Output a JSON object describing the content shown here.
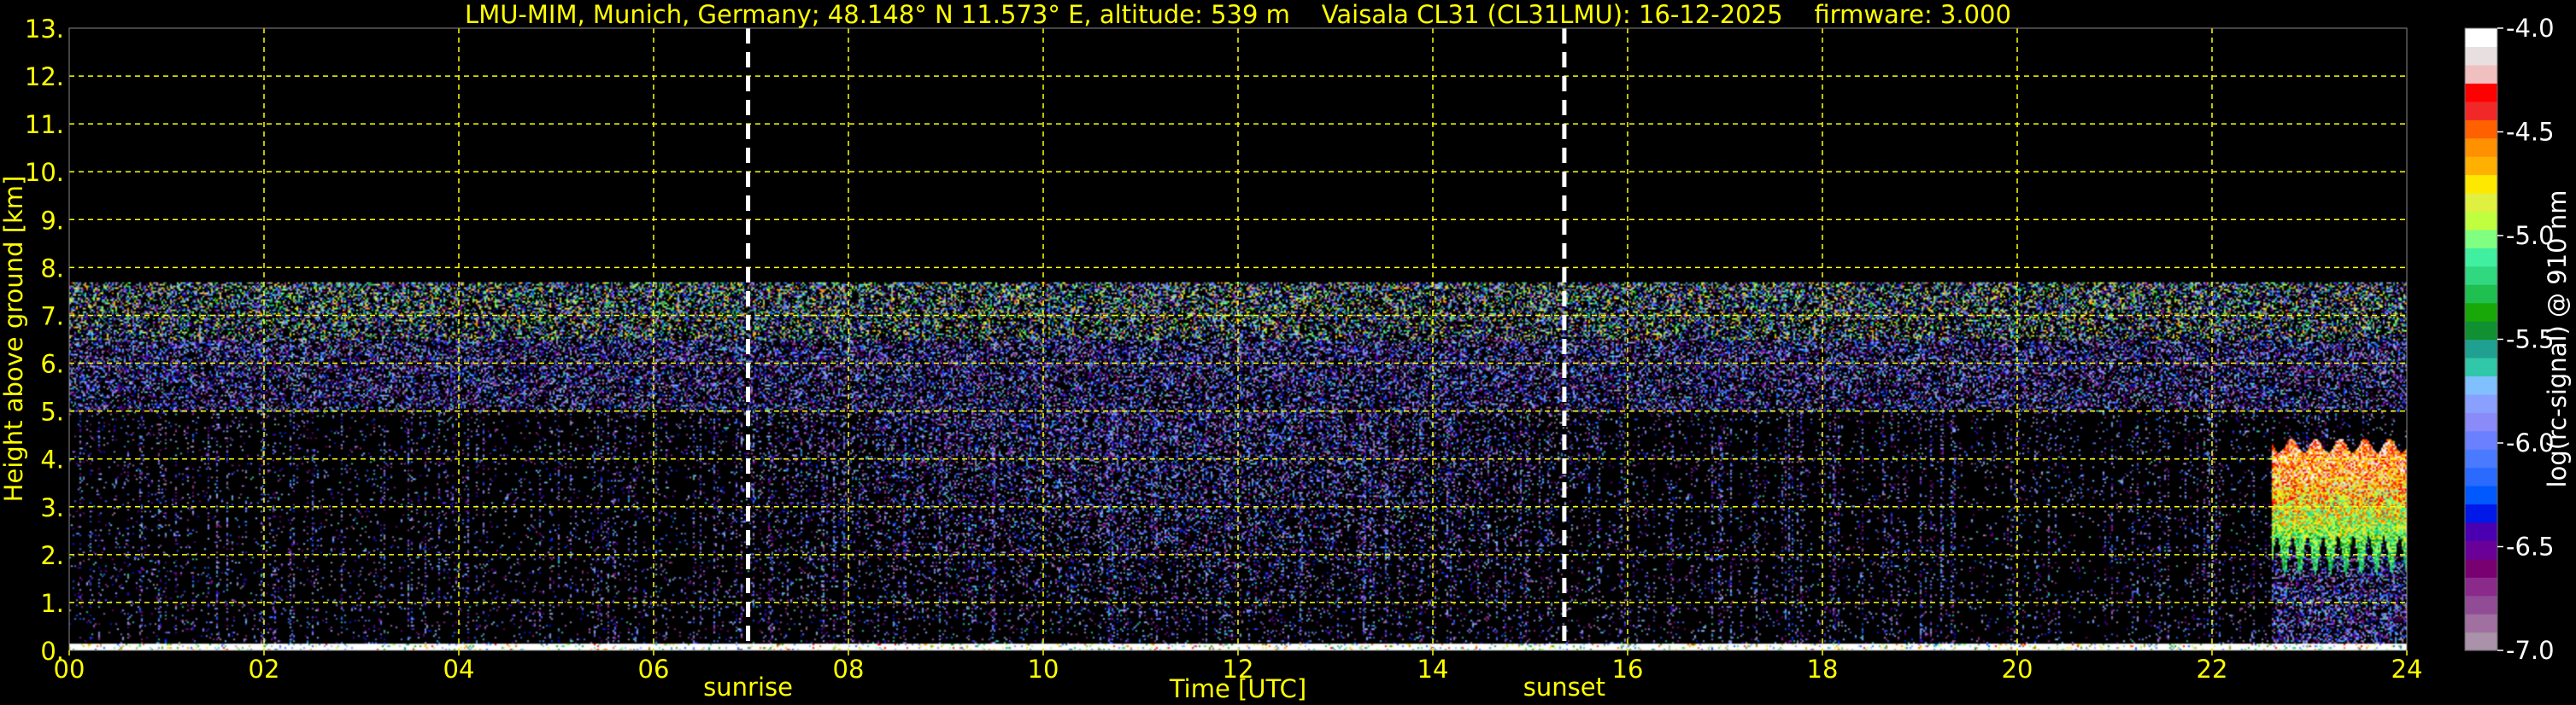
{
  "chart_data": {
    "type": "heatmap",
    "title": "LMU-MIM, Munich, Germany; 48.148° N 11.573° E, altitude: 539 m    Vaisala CL31 (CL31LMU): 16-12-2025    firmware: 3.000",
    "xlabel": "Time [UTC]",
    "ylabel": "Height above ground [km]",
    "xlim": [
      0,
      24
    ],
    "ylim": [
      0,
      13
    ],
    "x_ticks": [
      "00",
      "02",
      "04",
      "06",
      "08",
      "10",
      "12",
      "14",
      "16",
      "18",
      "20",
      "22",
      "24"
    ],
    "y_ticks": [
      "0.",
      "1.",
      "2.",
      "3.",
      "4.",
      "5.",
      "6.",
      "7.",
      "8.",
      "9.",
      "10.",
      "11.",
      "12.",
      "13."
    ],
    "grid": true,
    "annotations": [
      {
        "label": "sunrise",
        "time_h": 6.97
      },
      {
        "label": "sunset",
        "time_h": 15.35
      }
    ],
    "colorbar": {
      "label": "log(rc-signal) @ 910 nm",
      "range": [
        -7.0,
        -4.0
      ],
      "ticks": [
        "-7.0",
        "-6.5",
        "-6.0",
        "-5.5",
        "-5.0",
        "-4.5",
        "-4.0"
      ],
      "colors": [
        "#aa92aa",
        "#a070a0",
        "#904c94",
        "#8a2a8a",
        "#780070",
        "#6a0098",
        "#4a00b0",
        "#0018e8",
        "#0058ff",
        "#2a6aff",
        "#4a7aff",
        "#6a80ff",
        "#8a8af8",
        "#8aa0ff",
        "#80c0ff",
        "#30c8a8",
        "#20a090",
        "#109030",
        "#18a808",
        "#20c050",
        "#30d880",
        "#40f0a0",
        "#80ff80",
        "#c0ff40",
        "#e0f040",
        "#ffe800",
        "#ffb000",
        "#ff9000",
        "#ff6000",
        "#f02828",
        "#ff0000",
        "#f0c0c0",
        "#e8e0e0",
        "#ffffff"
      ]
    },
    "features": {
      "noise_top_km": 7.7,
      "surface_layer_top_km": 0.15,
      "cloud": {
        "start_h": 22.6,
        "end_h": 24,
        "base_km": 2.0,
        "top_km": 4.3
      }
    }
  }
}
